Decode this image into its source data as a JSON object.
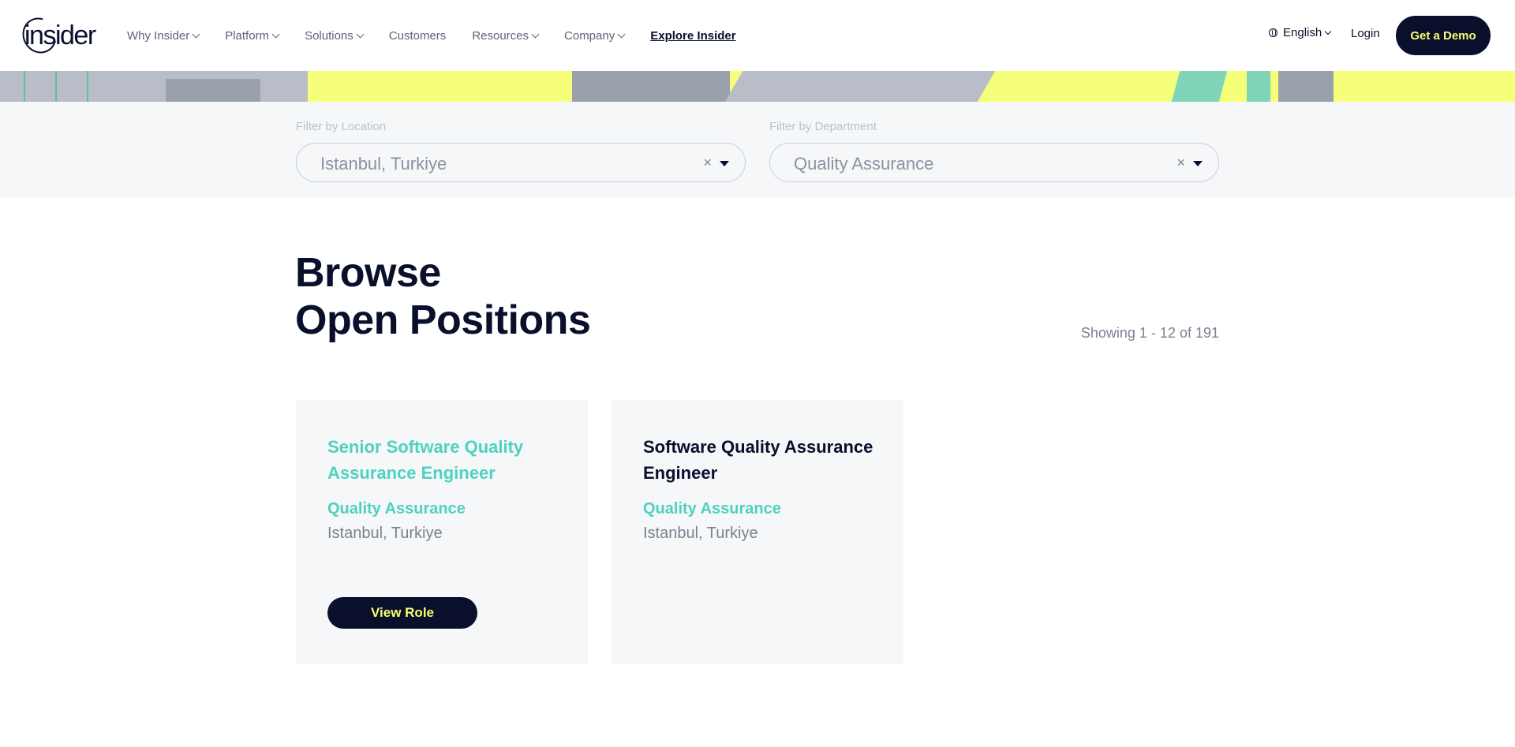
{
  "header": {
    "logo_text": "insider",
    "nav": [
      {
        "label": "Why Insider",
        "has_dropdown": true
      },
      {
        "label": "Platform",
        "has_dropdown": true
      },
      {
        "label": "Solutions",
        "has_dropdown": true
      },
      {
        "label": "Customers",
        "has_dropdown": false
      },
      {
        "label": "Resources",
        "has_dropdown": true
      },
      {
        "label": "Company",
        "has_dropdown": true
      },
      {
        "label": "Explore Insider",
        "has_dropdown": false
      }
    ],
    "language": "English",
    "login": "Login",
    "demo_button": "Get a Demo"
  },
  "filters": {
    "location": {
      "label": "Filter by Location",
      "value": "Istanbul, Turkiye",
      "clear": "×"
    },
    "department": {
      "label": "Filter by Department",
      "value": "Quality Assurance",
      "clear": "×"
    }
  },
  "main": {
    "title_line1": "Browse",
    "title_line2": "Open Positions",
    "showing": "Showing 1 - 12 of 191"
  },
  "jobs": [
    {
      "title": "Senior Software Quality Assurance Engineer",
      "department": "Quality Assurance",
      "location": "Istanbul, Turkiye",
      "button": "View Role",
      "title_color": "#4fd1c0"
    },
    {
      "title": "Software Quality Assurance Engineer",
      "department": "Quality Assurance",
      "location": "Istanbul, Turkiye",
      "title_color": "#0a0f2c"
    }
  ],
  "colors": {
    "brand_navy": "#0a0f2c",
    "accent_yellow": "#f5ff6b",
    "accent_teal": "#4fd1c0",
    "panel_bg": "#f5f7f9"
  }
}
